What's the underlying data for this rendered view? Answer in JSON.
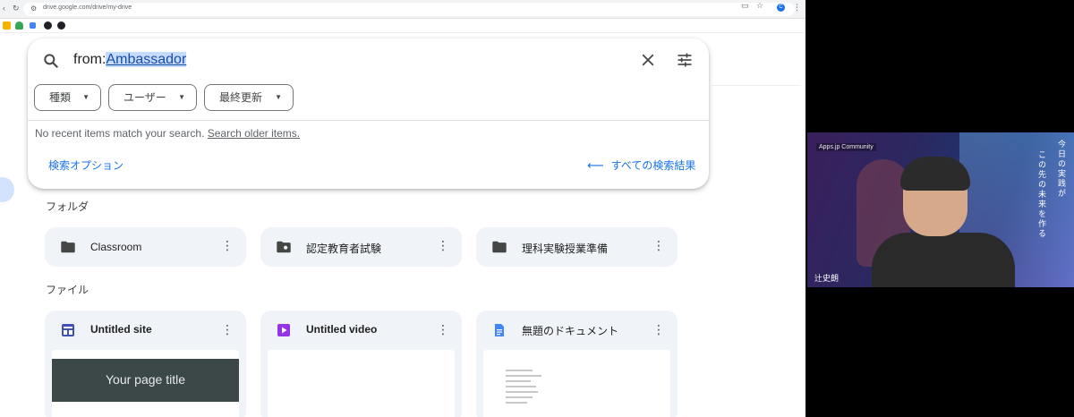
{
  "browser": {
    "url": "drive.google.com/drive/my-drive",
    "profile_initial": "C"
  },
  "search": {
    "query_prefix": "from:",
    "query_highlight": "Ambassador",
    "chips": [
      {
        "label": "種類"
      },
      {
        "label": "ユーザー"
      },
      {
        "label": "最終更新"
      }
    ],
    "no_recent_text": "No recent items match your search.",
    "search_older_link": "Search older items.",
    "options_link": "検索オプション",
    "all_results_link": "すべての検索結果"
  },
  "sections": {
    "folders_label": "フォルダ",
    "files_label": "ファイル"
  },
  "folders": [
    {
      "name": "Classroom",
      "icon": "folder-icon"
    },
    {
      "name": "認定教育者試験",
      "icon": "shared-folder-icon"
    },
    {
      "name": "理科実験授業準備",
      "icon": "folder-icon"
    }
  ],
  "files": [
    {
      "name": "Untitled site",
      "icon": "sites-icon",
      "thumb_title": "Your page title"
    },
    {
      "name": "Untitled video",
      "icon": "vids-icon"
    },
    {
      "name": "無題のドキュメント",
      "icon": "docs-icon"
    }
  ],
  "video": {
    "community_label": "Apps.jp Community",
    "speaker_name": "辻史朗",
    "overlay_col1": "今日の実践が",
    "overlay_col2": "この先の未来を作る"
  },
  "colors": {
    "accent": "#1a73e8",
    "card_bg": "#f0f4f9",
    "highlight": "#c6dafc"
  }
}
